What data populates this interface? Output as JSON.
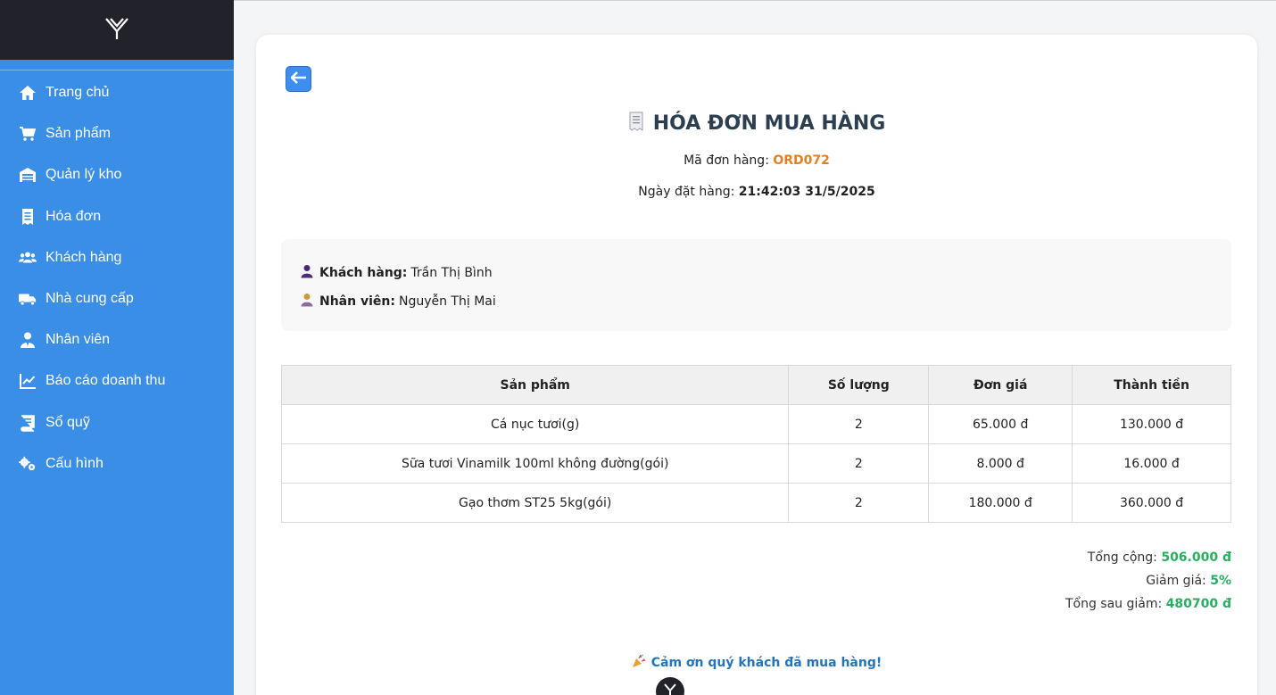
{
  "sidebar": {
    "items": [
      {
        "label": "Trang chủ",
        "icon": "home-icon"
      },
      {
        "label": "Sản phẩm",
        "icon": "cart-icon"
      },
      {
        "label": "Quản lý kho",
        "icon": "warehouse-icon"
      },
      {
        "label": "Hóa đơn",
        "icon": "receipt-icon"
      },
      {
        "label": "Khách hàng",
        "icon": "users-icon"
      },
      {
        "label": "Nhà cung cấp",
        "icon": "truck-icon"
      },
      {
        "label": "Nhân viên",
        "icon": "user-tie-icon"
      },
      {
        "label": "Báo cáo doanh thu",
        "icon": "chart-line-icon"
      },
      {
        "label": "Sổ quỹ",
        "icon": "book-icon"
      },
      {
        "label": "Cấu hình",
        "icon": "gears-icon"
      }
    ]
  },
  "invoice": {
    "title": "HÓA ĐƠN MUA HÀNG",
    "order_code_label": "Mã đơn hàng:",
    "order_code": "ORD072",
    "order_date_label": "Ngày đặt hàng:",
    "order_date": "21:42:03 31/5/2025",
    "customer_label": "Khách hàng:",
    "customer_name": "Trần Thị Bình",
    "staff_label": "Nhân viên:",
    "staff_name": "Nguyễn Thị Mai",
    "columns": [
      "Sản phẩm",
      "Số lượng",
      "Đơn giá",
      "Thành tiền"
    ],
    "rows": [
      {
        "product": "Cá nục tươi(g)",
        "qty": "2",
        "price": "65.000 đ",
        "total": "130.000 đ"
      },
      {
        "product": "Sữa tươi Vinamilk 100ml không đường(gói)",
        "qty": "2",
        "price": "8.000 đ",
        "total": "16.000 đ"
      },
      {
        "product": "Gạo thơm ST25 5kg(gói)",
        "qty": "2",
        "price": "180.000 đ",
        "total": "360.000 đ"
      }
    ],
    "subtotal_label": "Tổng cộng:",
    "subtotal": "506.000 đ",
    "discount_label": "Giảm giá:",
    "discount": "5%",
    "grand_total_label": "Tổng sau giảm:",
    "grand_total": "480700 đ",
    "thanks": "Cảm ơn quý khách đã mua hàng!"
  },
  "colors": {
    "sidebar": "#3a8ee6",
    "sidebar_top": "#22222b",
    "order_code": "#e67e22",
    "totals": "#27ae60",
    "thanks": "#2573b8"
  }
}
